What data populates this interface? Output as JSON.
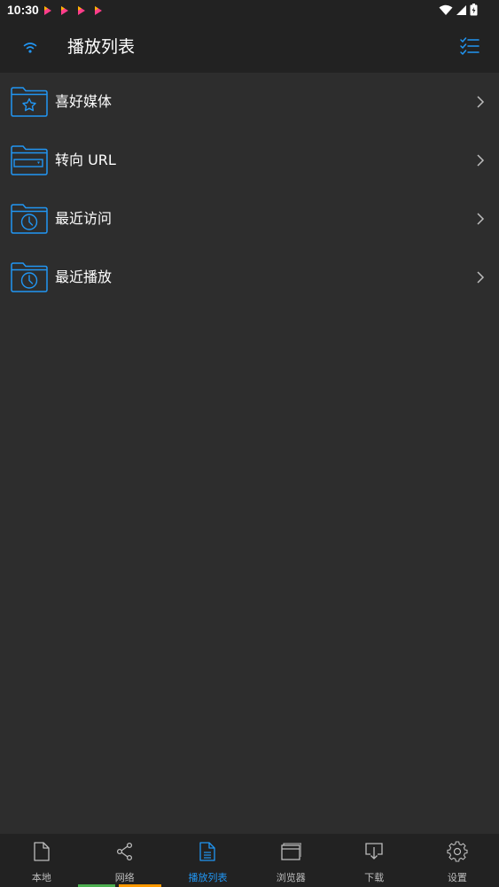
{
  "status_bar": {
    "time": "10:30",
    "notification_icons": [
      "play-icon",
      "play-icon",
      "play-icon",
      "play-icon"
    ],
    "system_icons": [
      "wifi-signal-icon",
      "cell-signal-icon",
      "battery-icon"
    ]
  },
  "app_bar": {
    "title": "播放列表",
    "left_icon": "wifi-icon",
    "right_icon": "checklist-icon"
  },
  "items": [
    {
      "label": "喜好媒体",
      "icon": "folder-star-icon"
    },
    {
      "label": "转向 URL",
      "icon": "folder-url-icon"
    },
    {
      "label": "最近访问",
      "icon": "folder-clock-icon"
    },
    {
      "label": "最近播放",
      "icon": "folder-clock-icon"
    }
  ],
  "bottom_nav": {
    "items": [
      {
        "label": "本地",
        "icon": "file-icon",
        "active": false
      },
      {
        "label": "网络",
        "icon": "share-icon",
        "active": false
      },
      {
        "label": "播放列表",
        "icon": "playlist-file-icon",
        "active": true
      },
      {
        "label": "浏览器",
        "icon": "browser-icon",
        "active": false
      },
      {
        "label": "下载",
        "icon": "download-icon",
        "active": false
      },
      {
        "label": "设置",
        "icon": "settings-icon",
        "active": false
      }
    ]
  },
  "colors": {
    "background": "#2d2d2d",
    "bar": "#222222",
    "accent": "#2196f3",
    "text": "#ffffff",
    "nav_text": "#bdbdbd"
  }
}
